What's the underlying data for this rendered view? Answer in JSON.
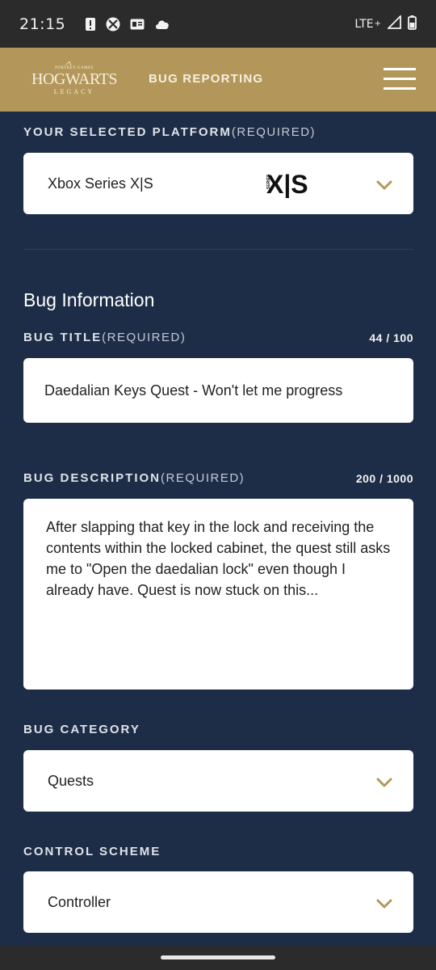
{
  "status_bar": {
    "time": "21:15",
    "network": "LTE",
    "icons": [
      "alert-icon",
      "xbox-icon",
      "news-icon",
      "cloud-icon",
      "signal-icon",
      "battery-icon"
    ]
  },
  "header": {
    "logo": {
      "top_text": "PORTKEY GAMES",
      "main": "HOGWARTS",
      "sub": "LEGACY"
    },
    "title": "BUG REPORTING"
  },
  "platform": {
    "label": "YOUR SELECTED PLATFORM",
    "required": "(REQUIRED)",
    "value": "Xbox Series X|S",
    "logo_text": "X|S",
    "logo_sub": "SERIES"
  },
  "bug_info": {
    "heading": "Bug Information",
    "title": {
      "label": "BUG TITLE",
      "required": "(REQUIRED)",
      "counter": "44 / 100",
      "value": "Daedalian Keys Quest - Won't let me progress"
    },
    "description": {
      "label": "BUG DESCRIPTION",
      "required": "(REQUIRED)",
      "counter": "200 / 1000",
      "value": "After slapping that key in the lock and receiving the contents within the locked cabinet, the quest still asks me to \"Open the daedalian lock\" even though I already have. Quest is now stuck on this..."
    },
    "category": {
      "label": "BUG CATEGORY",
      "value": "Quests"
    },
    "control_scheme": {
      "label": "CONTROL SCHEME",
      "value": "Controller"
    }
  },
  "colors": {
    "background": "#1e2d47",
    "header_gold": "#b3975a",
    "chevron_gold": "#b29859"
  }
}
